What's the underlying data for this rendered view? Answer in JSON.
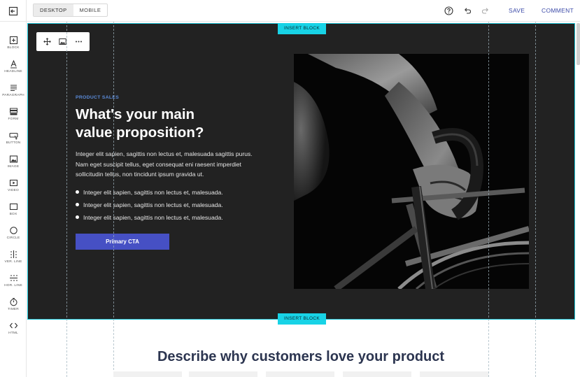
{
  "topbar": {
    "views": [
      {
        "label": "DESKTOP"
      },
      {
        "label": "MOBILE"
      }
    ],
    "save_label": "SAVE",
    "comment_label": "COMMENT"
  },
  "sidebar": {
    "tools": [
      {
        "label": "BLOCK",
        "icon": "block-icon"
      },
      {
        "label": "HEADLINE",
        "icon": "headline-icon"
      },
      {
        "label": "PARAGRAPH",
        "icon": "paragraph-icon"
      },
      {
        "label": "FORM",
        "icon": "form-icon"
      },
      {
        "label": "BUTTON",
        "icon": "button-icon"
      },
      {
        "label": "IMAGE",
        "icon": "image-icon"
      },
      {
        "label": "VIDEO",
        "icon": "video-icon"
      },
      {
        "label": "BOX",
        "icon": "box-icon"
      },
      {
        "label": "CIRCLE",
        "icon": "circle-icon"
      },
      {
        "label": "VER. LINE",
        "icon": "vertical-line-icon"
      },
      {
        "label": "HOR. LINE",
        "icon": "horizontal-line-icon"
      },
      {
        "label": "TIMER",
        "icon": "timer-icon"
      },
      {
        "label": "HTML",
        "icon": "html-icon"
      }
    ]
  },
  "canvas": {
    "insert_top": "INSERT BLOCK",
    "insert_bottom": "INSERT BLOCK",
    "hero": {
      "eyebrow": "PRODUCT SALES",
      "headline_line1": "What's your main",
      "headline_line2": "value proposition?",
      "body": "Integer elit sapien, sagittis non lectus et, malesuada sagittis purus. Nam eget suscipit tellus, eget consequat eni raesent imperdiet sollicitudin tellus, non tincidunt ipsum gravida ut.",
      "bullets": [
        "Integer elit sapien, sagittis non lectus et, malesuada.",
        "Integer elit sapien, sagittis non lectus et, malesuada.",
        "Integer elit sapien, sagittis non lectus et, malesuada."
      ],
      "cta_label": "Primary CTA"
    },
    "section2_title": "Describe why customers love your product"
  },
  "colors": {
    "accent": "#4650c4",
    "selection": "#18d3e6",
    "hero_bg": "#222222",
    "eyebrow": "#5b8bd9"
  }
}
